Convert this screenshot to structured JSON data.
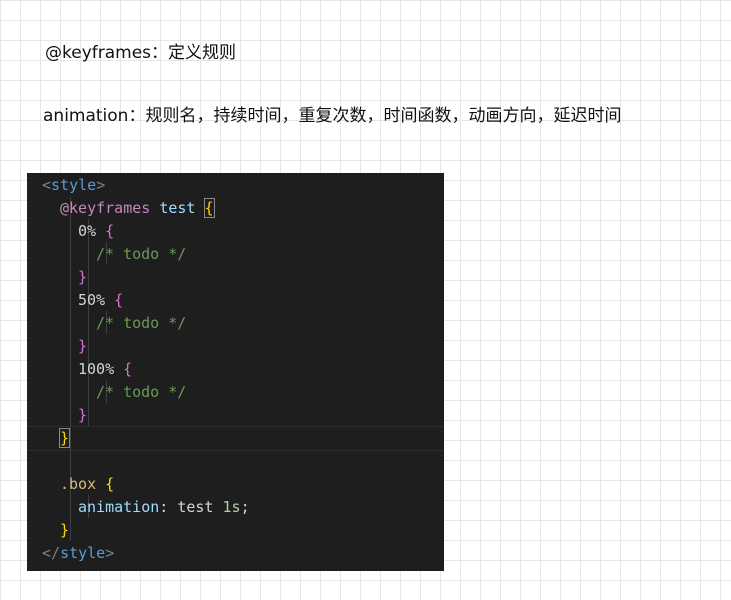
{
  "notes": {
    "keyframes_line": "@keyframes：定义规则",
    "animation_line": "animation：规则名，持续时间，重复次数，时间函数，动画方向，延迟时间"
  },
  "code": {
    "style_open_lt": "<",
    "style_tag": "style",
    "style_open_gt": ">",
    "keyframes_kw": "@keyframes",
    "keyframes_name": "test",
    "open_brace": "{",
    "close_brace": "}",
    "pct_0": "0%",
    "pct_50": "50%",
    "pct_100": "100%",
    "comment": "/* todo */",
    "selector": ".box",
    "property": "animation",
    "colon": ":",
    "anim_value_name": "test",
    "anim_value_dur": "1s",
    "semicolon": ";",
    "style_close_lt": "</",
    "style_close_gt": ">"
  },
  "colors": {
    "editor_bg": "#1e1e1e",
    "tag": "#569cd6",
    "at_rule": "#c586c0",
    "bracket_gold": "#ffd700",
    "bracket_purple": "#da70d6",
    "comment": "#6a9955",
    "selector": "#d7ba7d",
    "property": "#9cdcfe",
    "number": "#b5cea8"
  }
}
